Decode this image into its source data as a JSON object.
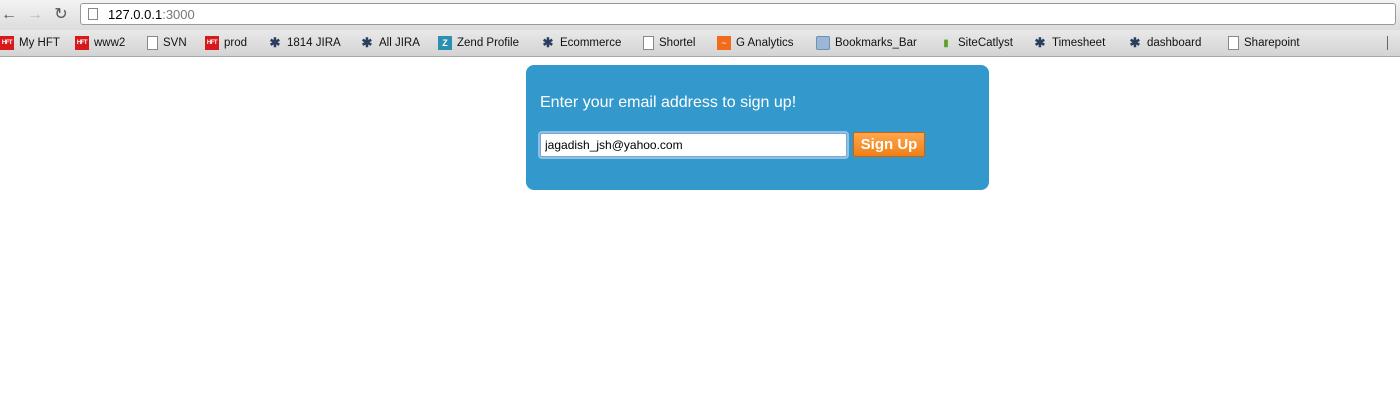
{
  "browser": {
    "url_host": "127.0.0.1",
    "url_port": ":3000",
    "nav": {
      "back": "←",
      "forward": "→",
      "reload": "↻"
    }
  },
  "bookmarks": [
    {
      "label": "My HFT",
      "icon": "hft-icon"
    },
    {
      "label": "www2",
      "icon": "hft-icon"
    },
    {
      "label": "SVN",
      "icon": "page-icon"
    },
    {
      "label": "prod",
      "icon": "hft-icon"
    },
    {
      "label": "1814 JIRA",
      "icon": "jira-icon"
    },
    {
      "label": "All JIRA",
      "icon": "jira-icon"
    },
    {
      "label": "Zend Profile",
      "icon": "zend-icon"
    },
    {
      "label": "Ecommerce",
      "icon": "jira-icon"
    },
    {
      "label": "Shortel",
      "icon": "page-icon"
    },
    {
      "label": "G Analytics",
      "icon": "analytics-icon"
    },
    {
      "label": "Bookmarks_Bar",
      "icon": "folder-icon"
    },
    {
      "label": "SiteCatlyst",
      "icon": "bars-icon"
    },
    {
      "label": "Timesheet",
      "icon": "jira-icon"
    },
    {
      "label": "dashboard",
      "icon": "jira-icon"
    },
    {
      "label": "Sharepoint",
      "icon": "page-icon"
    }
  ],
  "signup": {
    "heading": "Enter your email address to sign up!",
    "email_value": "jagadish_jsh@yahoo.com",
    "button_label": "Sign Up"
  },
  "colors": {
    "panel": "#3399cc",
    "button": "#f08a24"
  }
}
